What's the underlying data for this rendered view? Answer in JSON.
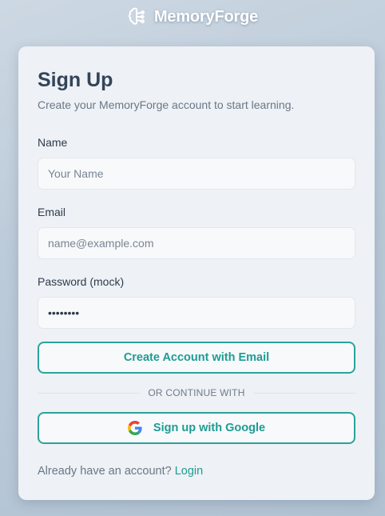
{
  "brand": {
    "name": "MemoryForge",
    "icon": "brain-icon"
  },
  "form": {
    "title": "Sign Up",
    "subtitle": "Create your MemoryForge account to start learning.",
    "name": {
      "label": "Name",
      "placeholder": "Your Name",
      "value": ""
    },
    "email": {
      "label": "Email",
      "placeholder": "name@example.com",
      "value": ""
    },
    "password": {
      "label": "Password (mock)",
      "value": "password"
    },
    "create_button": "Create Account with Email",
    "divider": "OR CONTINUE WITH",
    "google_button": "Sign up with Google",
    "footer": {
      "prompt": "Already have an account?",
      "link": "Login"
    }
  },
  "colors": {
    "accent": "#2aa39b",
    "background": "#bccbd9",
    "card": "#eef1f5",
    "title": "#33445a"
  }
}
